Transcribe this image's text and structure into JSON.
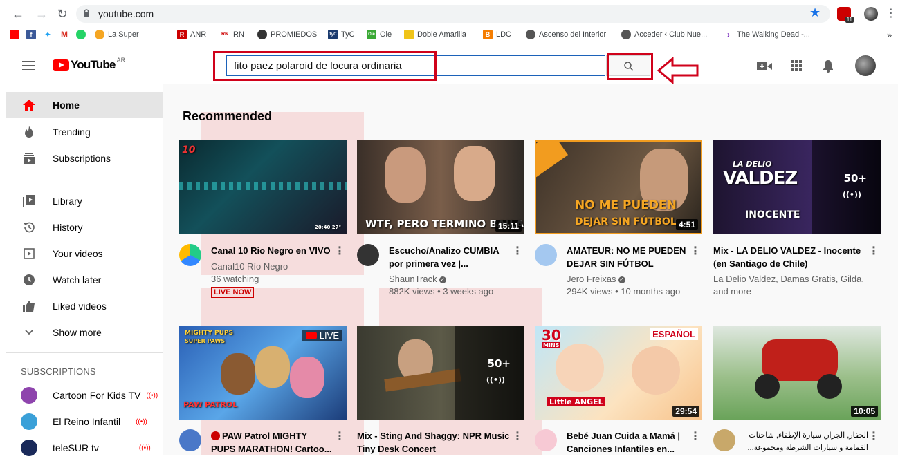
{
  "browser": {
    "url": "youtube.com",
    "bookmarks": [
      "La Super",
      "ANR",
      "RN",
      "PROMIEDOS",
      "TyC",
      "Ole",
      "Doble Amarilla",
      "LDC",
      "Ascenso del Interior",
      "Acceder ‹ Club Nue...",
      "The Walking Dead -..."
    ],
    "bookmark_icon_labels": {
      "anr": "R",
      "rn": "RN",
      "tyc": "TyC",
      "ole": "Olé",
      "ldc": "B"
    },
    "overflow": "»",
    "extension_badge": "11"
  },
  "header": {
    "logo_text": "YouTube",
    "region": "AR",
    "search_value": "fito paez polaroid de locura ordinaria",
    "search_placeholder": "Search"
  },
  "sidebar": {
    "items": [
      {
        "label": "Home",
        "icon": "home-icon"
      },
      {
        "label": "Trending",
        "icon": "trending-icon"
      },
      {
        "label": "Subscriptions",
        "icon": "subscriptions-icon"
      },
      {
        "label": "Library",
        "icon": "library-icon"
      },
      {
        "label": "History",
        "icon": "history-icon"
      },
      {
        "label": "Your videos",
        "icon": "your-videos-icon"
      },
      {
        "label": "Watch later",
        "icon": "watch-later-icon"
      },
      {
        "label": "Liked videos",
        "icon": "liked-icon"
      },
      {
        "label": "Show more",
        "icon": "chevron-down-icon"
      }
    ],
    "subscriptions_heading": "SUBSCRIPTIONS",
    "subscriptions": [
      {
        "label": "Cartoon For Kids TV",
        "live": true
      },
      {
        "label": "El Reino Infantil",
        "live": true
      },
      {
        "label": "teleSUR tv",
        "live": true
      }
    ]
  },
  "main": {
    "heading": "Recommended",
    "videos": [
      {
        "title": "Canal 10 Rio Negro en VIVO",
        "channel": "Canal10 Río Negro",
        "meta": "36 watching",
        "badge": "LIVE NOW",
        "thumb_text": "",
        "thumb_time": "20:40  27°",
        "thumb_corner": "10"
      },
      {
        "title": "Escucho/Analizo CUMBIA por primera vez |...",
        "channel": "ShaunTrack",
        "meta": "882K views • 3 weeks ago",
        "duration": "15:11",
        "thumb_text": "WTF, PERO TERMINO BAILANDO"
      },
      {
        "title": "AMATEUR: NO ME PUEDEN DEJAR SIN FÚTBOL",
        "channel": "Jero Freixas",
        "meta": "294K views • 10 months ago",
        "duration": "4:51",
        "thumb_text": "NO ME PUEDEN",
        "thumb_text2": "DEJAR SIN FÚTBOL"
      },
      {
        "title": "Mix - LA DELIO VALDEZ - Inocente (en Santiago de Chile)",
        "channel": "La Delio Valdez, Damas Gratis, Gilda, and more",
        "thumb_text": "VALDEZ",
        "thumb_text_small": "LA DELIO",
        "thumb_text2": "INOCENTE",
        "thumb_count": "50+"
      },
      {
        "title": "PAW Patrol MIGHTY PUPS MARATHON! Cartoo...",
        "thumb_badge": "LIVE",
        "thumb_text": "MIGHTY PUPS",
        "thumb_text_small": "SUPER PAWS",
        "thumb_logo": "PAW PATROL"
      },
      {
        "title": "Mix - Sting And Shaggy: NPR Music Tiny Desk Concert",
        "thumb_count": "50+"
      },
      {
        "title": "Bebé Juan Cuida a Mamá | Canciones Infantiles en...",
        "duration": "29:54",
        "thumb_badge": "ESPAÑOL",
        "thumb_num": "30",
        "thumb_mins": "MINS",
        "thumb_logo": "Little ANGEL"
      },
      {
        "title": "الحفار, الجرار, سيارة الإطفاء, شاحنات القمامة و سيارات الشرطة ومجموعة...",
        "duration": "10:05"
      }
    ]
  },
  "colors": {
    "brand_red": "#ff0000",
    "annotation_red": "#d0021b",
    "search_border": "#1c62b9"
  }
}
